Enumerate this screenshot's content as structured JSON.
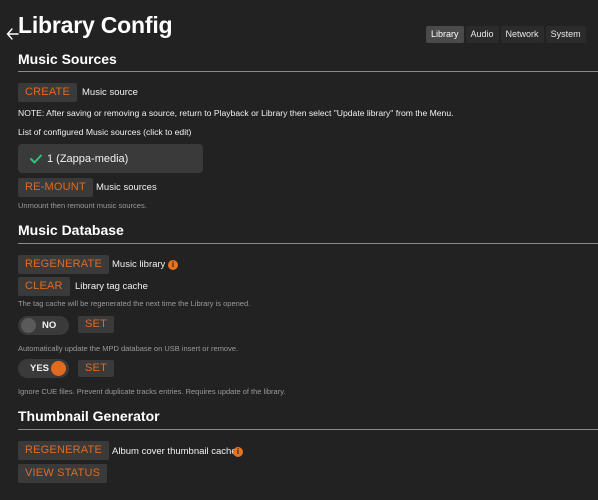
{
  "header": {
    "title": "Library Config",
    "tabs": [
      {
        "label": "Library",
        "active": true
      },
      {
        "label": "Audio"
      },
      {
        "label": "Network"
      },
      {
        "label": "System"
      }
    ]
  },
  "colors": {
    "accent": "#e06b1f",
    "background": "#222222",
    "button_bg": "#3a3a3a",
    "check": "#2ec27e"
  },
  "music_sources": {
    "title": "Music Sources",
    "create_button": "CREATE",
    "create_label": "Music source",
    "note": "NOTE: After saving or removing a source, return to Playback or Library then select \"Update library\" from the Menu.",
    "list_caption": "List of configured Music sources (click to edit)",
    "items": [
      {
        "label": "1 (Zappa-media)",
        "status": "check-icon"
      }
    ],
    "remount_button": "RE-MOUNT",
    "remount_label": "Music sources",
    "remount_help": "Unmount then remount music sources."
  },
  "music_database": {
    "title": "Music Database",
    "regenerate_button": "REGENERATE",
    "regenerate_label": "Music library",
    "clear_button": "CLEAR",
    "clear_label": "Library tag cache",
    "clear_help": "The tag cache will be regenerated the next time the Library is opened.",
    "usb_toggle": {
      "value": "NO",
      "on": false
    },
    "usb_set_button": "SET",
    "usb_help": "Automatically update the MPD database on USB insert or remove.",
    "cue_toggle": {
      "value": "YES",
      "on": true
    },
    "cue_set_button": "SET",
    "cue_help": "Ignore CUE files. Prevent duplicate tracks entries. Requires update of the library."
  },
  "thumbnail_generator": {
    "title": "Thumbnail Generator",
    "regenerate_button": "REGENERATE",
    "regenerate_label": "Album cover thumbnail cache",
    "view_status_button": "VIEW STATUS"
  }
}
